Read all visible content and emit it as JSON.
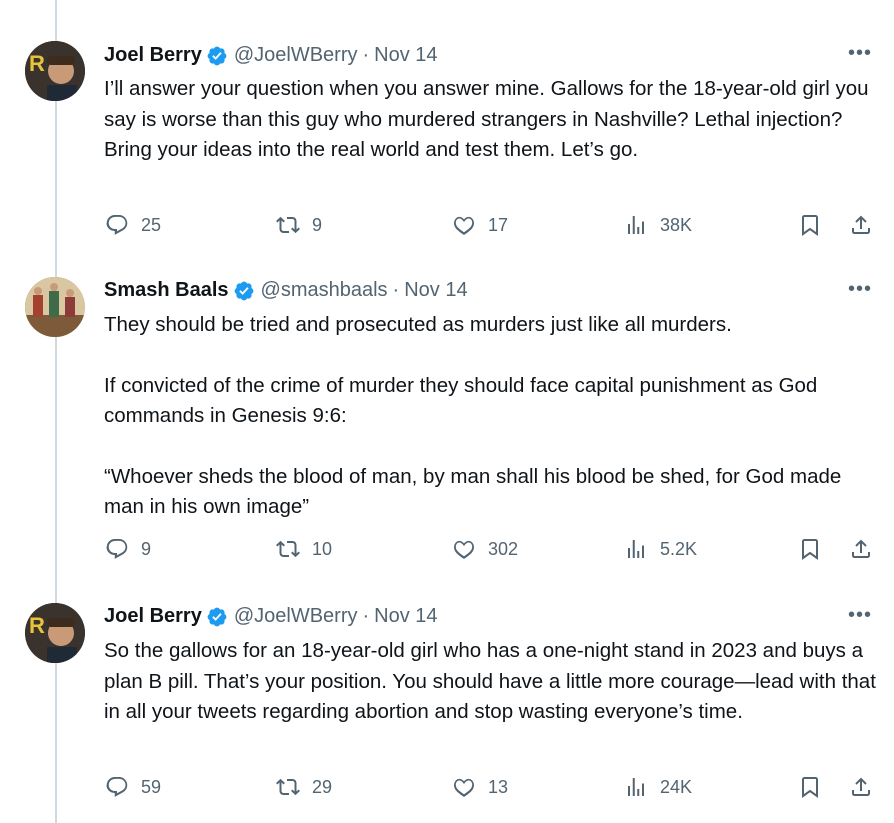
{
  "tweets": [
    {
      "name": "Joel Berry",
      "handle": "@JoelWBerry",
      "date": "Nov 14",
      "paragraphs": [
        "I’ll answer your question when you answer mine. Gallows for the 18-year-old girl you say is worse than this guy who murdered strangers in Nashville? Lethal injection? Bring your ideas into the real world and test them. Let’s go."
      ],
      "replies": "25",
      "retweets": "9",
      "likes": "17",
      "views": "38K"
    },
    {
      "name": "Smash Baals",
      "handle": "@smashbaals",
      "date": "Nov 14",
      "paragraphs": [
        "They should be tried and prosecuted as murders just like all murders.",
        "If convicted of the crime of murder they should face capital punishment as God commands in Genesis 9:6:",
        "“Whoever sheds the blood of man, by man shall his blood be shed, for God made man in his own image”"
      ],
      "replies": "9",
      "retweets": "10",
      "likes": "302",
      "views": "5.2K"
    },
    {
      "name": "Joel Berry",
      "handle": "@JoelWBerry",
      "date": "Nov 14",
      "paragraphs": [
        "So the gallows for an 18-year-old girl who has a one-night stand in 2023 and buys a plan B pill. That’s your position. You should have a little more courage—lead with that in all your tweets regarding abortion and stop wasting everyone’s time."
      ],
      "replies": "59",
      "retweets": "29",
      "likes": "13",
      "views": "24K"
    }
  ],
  "colors": {
    "text": "#0f1419",
    "muted": "#536471",
    "verified": "#1d9bf0",
    "thread_line": "#cfd9de"
  },
  "icons": [
    "more-icon",
    "verified-badge-icon",
    "reply-icon",
    "retweet-icon",
    "like-icon",
    "views-icon",
    "bookmark-icon",
    "share-icon"
  ]
}
